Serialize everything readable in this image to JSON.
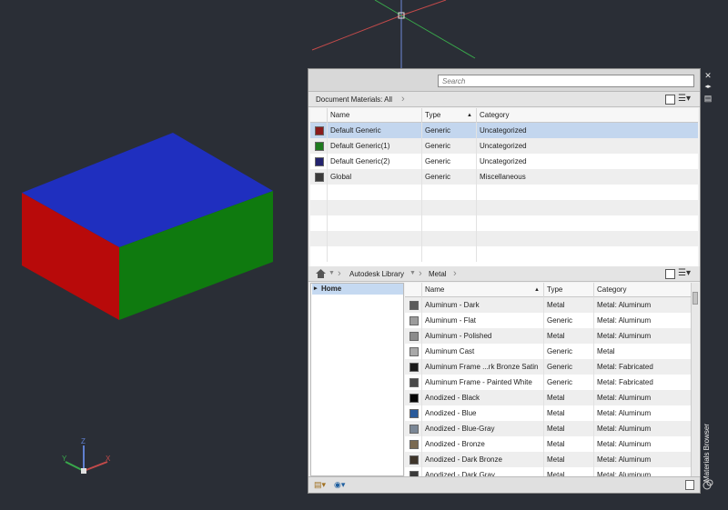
{
  "window": {
    "search_placeholder": "Search",
    "side_title": "Materials Browser",
    "close_glyph": "✕",
    "autohide_glyph": "◂▸",
    "properties_glyph": "▤"
  },
  "document_materials": {
    "breadcrumb": "Document Materials: All",
    "columns": [
      "Name",
      "Type",
      "Category"
    ],
    "sort_indicator": "▲",
    "rows": [
      {
        "name": "Default Generic",
        "type": "Generic",
        "category": "Uncategorized",
        "swatch": "#8b1c1c",
        "selected": true
      },
      {
        "name": "Default Generic(1)",
        "type": "Generic",
        "category": "Uncategorized",
        "swatch": "#1e7a1e",
        "selected": false
      },
      {
        "name": "Default Generic(2)",
        "type": "Generic",
        "category": "Uncategorized",
        "swatch": "#23236e",
        "selected": false
      },
      {
        "name": "Global",
        "type": "Generic",
        "category": "Miscellaneous",
        "swatch": "#3a3a3a",
        "selected": false
      }
    ]
  },
  "library": {
    "breadcrumb_home_icon": "home-icon",
    "breadcrumb": [
      "Autodesk Library",
      "Metal"
    ],
    "tree": {
      "home": "Home"
    },
    "columns": [
      "Name",
      "Type",
      "Category"
    ],
    "sort_indicator": "▲",
    "rows": [
      {
        "name": "Aluminum - Dark",
        "type": "Metal",
        "category": "Metal: Aluminum",
        "swatch": "#5b5b5b"
      },
      {
        "name": "Aluminum - Flat",
        "type": "Generic",
        "category": "Metal: Aluminum",
        "swatch": "#9c9c9c"
      },
      {
        "name": "Aluminum - Polished",
        "type": "Metal",
        "category": "Metal: Aluminum",
        "swatch": "#8c8c8c"
      },
      {
        "name": "Aluminum Cast",
        "type": "Generic",
        "category": "Metal",
        "swatch": "#a8a8a8"
      },
      {
        "name": "Aluminum Frame ...rk Bronze Satin",
        "type": "Generic",
        "category": "Metal: Fabricated",
        "swatch": "#1a1a1a"
      },
      {
        "name": "Aluminum Frame - Painted White",
        "type": "Generic",
        "category": "Metal: Fabricated",
        "swatch": "#4a4a4a"
      },
      {
        "name": "Anodized - Black",
        "type": "Metal",
        "category": "Metal: Aluminum",
        "swatch": "#050505"
      },
      {
        "name": "Anodized - Blue",
        "type": "Metal",
        "category": "Metal: Aluminum",
        "swatch": "#2a5a9a"
      },
      {
        "name": "Anodized - Blue-Gray",
        "type": "Metal",
        "category": "Metal: Aluminum",
        "swatch": "#7b8796"
      },
      {
        "name": "Anodized - Bronze",
        "type": "Metal",
        "category": "Metal: Aluminum",
        "swatch": "#7a6a52"
      },
      {
        "name": "Anodized - Dark Bronze",
        "type": "Metal",
        "category": "Metal: Aluminum",
        "swatch": "#3e352a"
      },
      {
        "name": "Anodized - Dark Gray",
        "type": "Metal",
        "category": "Metal: Aluminum",
        "swatch": "#3a3a3a"
      }
    ]
  },
  "viewport": {
    "ucs_labels": {
      "x": "X",
      "y": "Y",
      "z": "Z"
    },
    "box_colors": {
      "top": "#1f2fbf",
      "front": "#b80a0a",
      "side": "#0f7a0f"
    }
  }
}
